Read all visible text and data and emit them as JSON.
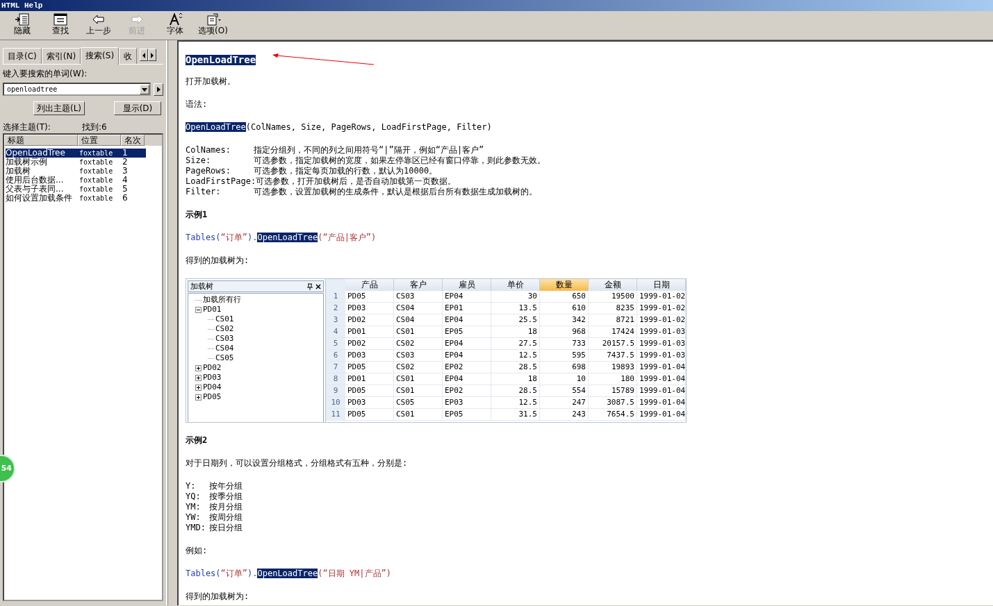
{
  "window": {
    "title": "HTML Help"
  },
  "toolbar": [
    {
      "kind": "hide",
      "label": "隐藏",
      "disabled": false
    },
    {
      "kind": "find",
      "label": "查找",
      "disabled": false
    },
    {
      "kind": "back",
      "label": "上一步",
      "disabled": false
    },
    {
      "kind": "forward",
      "label": "前进",
      "disabled": true
    },
    {
      "kind": "font",
      "label": "字体",
      "disabled": false
    },
    {
      "kind": "options",
      "label": "选项(O)",
      "disabled": false
    }
  ],
  "tabs": [
    {
      "label": "目录(C)",
      "selected": false
    },
    {
      "label": "索引(N)",
      "selected": false
    },
    {
      "label": "搜索(S)",
      "selected": true
    },
    {
      "label": "收",
      "selected": false
    }
  ],
  "search": {
    "label": "键入要搜索的单词(W):",
    "value": "openloadtree"
  },
  "buttons": [
    "列出主题(L)",
    "显示(D)"
  ],
  "results": {
    "label": "选择主题(T):",
    "found": "找到:6",
    "columns": [
      "标题",
      "位置",
      "名次"
    ],
    "rows": [
      {
        "title": "OpenLoadTree",
        "location": "foxtable",
        "rank": "1",
        "selected": true
      },
      {
        "title": "加载树示例",
        "location": "foxtable",
        "rank": "2",
        "selected": false
      },
      {
        "title": "加载树",
        "location": "foxtable",
        "rank": "3",
        "selected": false
      },
      {
        "title": "使用后台数据...",
        "location": "foxtable",
        "rank": "4",
        "selected": false
      },
      {
        "title": "父表与子表同...",
        "location": "foxtable",
        "rank": "5",
        "selected": false
      },
      {
        "title": "如何设置加载条件",
        "location": "foxtable",
        "rank": "6",
        "selected": false
      }
    ]
  },
  "badge": "54",
  "content": {
    "heading": "OpenLoadTree",
    "blocks": [
      {
        "kind": "para",
        "text": "打开加载树。"
      },
      {
        "kind": "para",
        "text": "语法:"
      },
      {
        "kind": "code",
        "parts": [
          {
            "kind": "highlight",
            "text": "OpenLoadTree"
          },
          {
            "kind": "plain",
            "text": "(ColNames, Size, PageRows, LoadFirstPage, Filter)"
          }
        ]
      },
      {
        "kind": "params",
        "items": [
          {
            "name": "ColNames:",
            "desc": "指定分组列，不同的列之间用符号“|”隔开，例如“产品|客户”"
          },
          {
            "name": "Size:",
            "desc": "可选参数，指定加载树的宽度，如果左停靠区已经有窗口停靠，则此参数无效。"
          },
          {
            "name": "PageRows:",
            "desc": "可选参数，指定每页加载的行数，默认为10000。"
          },
          {
            "name": "LoadFirstPage:",
            "desc": "可选参数，打开加载树后，是否自动加载第一页数据。"
          },
          {
            "name": "Filter:",
            "desc": "可选参数，设置加载树的生成条件，默认是根据后台所有数据生成加载树的。"
          }
        ]
      },
      {
        "kind": "title",
        "text": "示例1"
      },
      {
        "kind": "code",
        "parts": [
          {
            "kind": "object",
            "text": "Tables("
          },
          {
            "kind": "string",
            "text": "“订单”"
          },
          {
            "kind": "object",
            "text": ")."
          },
          {
            "kind": "highlight",
            "text": "OpenLoadTree"
          },
          {
            "kind": "string",
            "text": "(“产品|客户”)"
          }
        ]
      },
      {
        "kind": "para",
        "text": "得到的加载树为:"
      },
      {
        "kind": "treegrid",
        "tree_title": "加载树",
        "tree": [
          {
            "kind": "leaf",
            "label": "加载所有行"
          },
          {
            "kind": "group",
            "label": "PD01",
            "expanded": true,
            "children": [
              {
                "kind": "leaf",
                "label": "CS01"
              },
              {
                "kind": "leaf",
                "label": "CS02"
              },
              {
                "kind": "leaf",
                "label": "CS03"
              },
              {
                "kind": "leaf",
                "label": "CS04"
              },
              {
                "kind": "leaf",
                "label": "CS05"
              }
            ]
          },
          {
            "kind": "group",
            "label": "PD02",
            "expanded": false
          },
          {
            "kind": "group",
            "label": "PD03",
            "expanded": false
          },
          {
            "kind": "group",
            "label": "PD04",
            "expanded": false
          },
          {
            "kind": "group",
            "label": "PD05",
            "expanded": false
          }
        ],
        "columns": [
          {
            "label": "产品",
            "kind": "text",
            "selected": false
          },
          {
            "label": "客户",
            "kind": "text",
            "selected": false
          },
          {
            "label": "雇员",
            "kind": "text",
            "selected": false
          },
          {
            "label": "单价",
            "kind": "number",
            "selected": false
          },
          {
            "label": "数量",
            "kind": "number",
            "selected": true
          },
          {
            "label": "金额",
            "kind": "number",
            "selected": false
          },
          {
            "label": "日期",
            "kind": "number",
            "selected": false
          }
        ],
        "rows": [
          {
            "num": "1",
            "cells": [
              "PD05",
              "CS03",
              "EP04",
              "30",
              "650",
              "19500",
              "1999-01-02"
            ]
          },
          {
            "num": "2",
            "cells": [
              "PD03",
              "CS04",
              "EP01",
              "13.5",
              "610",
              "8235",
              "1999-01-02"
            ]
          },
          {
            "num": "3",
            "cells": [
              "PD02",
              "CS04",
              "EP04",
              "25.5",
              "342",
              "8721",
              "1999-01-02"
            ]
          },
          {
            "num": "4",
            "cells": [
              "PD01",
              "CS01",
              "EP05",
              "18",
              "968",
              "17424",
              "1999-01-03"
            ]
          },
          {
            "num": "5",
            "cells": [
              "PD02",
              "CS02",
              "EP04",
              "27.5",
              "733",
              "20157.5",
              "1999-01-03"
            ]
          },
          {
            "num": "6",
            "cells": [
              "PD03",
              "CS03",
              "EP04",
              "12.5",
              "595",
              "7437.5",
              "1999-01-03"
            ]
          },
          {
            "num": "7",
            "cells": [
              "PD05",
              "CS02",
              "EP02",
              "28.5",
              "698",
              "19893",
              "1999-01-04"
            ]
          },
          {
            "num": "8",
            "cells": [
              "PD01",
              "CS01",
              "EP04",
              "18",
              "10",
              "180",
              "1999-01-04"
            ]
          },
          {
            "num": "9",
            "cells": [
              "PD05",
              "CS01",
              "EP02",
              "28.5",
              "554",
              "15789",
              "1999-01-04"
            ]
          },
          {
            "num": "10",
            "cells": [
              "PD03",
              "CS05",
              "EP03",
              "12.5",
              "247",
              "3087.5",
              "1999-01-04"
            ]
          },
          {
            "num": "11",
            "cells": [
              "PD05",
              "CS01",
              "EP05",
              "31.5",
              "243",
              "7654.5",
              "1999-01-04"
            ]
          }
        ]
      },
      {
        "kind": "title",
        "text": "示例2"
      },
      {
        "kind": "para",
        "text": "对于日期列，可以设置分组格式，分组格式有五种，分别是:"
      },
      {
        "kind": "params",
        "items": [
          {
            "name": "Y:",
            "desc": "按年分组"
          },
          {
            "name": "YQ:",
            "desc": "按季分组"
          },
          {
            "name": "YM:",
            "desc": "按月分组"
          },
          {
            "name": "YW:",
            "desc": "按周分组"
          },
          {
            "name": "YMD:",
            "desc": "按日分组"
          }
        ]
      },
      {
        "kind": "para",
        "text": "例如:"
      },
      {
        "kind": "code",
        "parts": [
          {
            "kind": "object",
            "text": "Tables("
          },
          {
            "kind": "string",
            "text": "“订单”"
          },
          {
            "kind": "object",
            "text": ")."
          },
          {
            "kind": "highlight",
            "text": "OpenLoadTree"
          },
          {
            "kind": "string",
            "text": "(“日期 YM|产品”)"
          }
        ]
      },
      {
        "kind": "para",
        "text": "得到的加载树为:"
      }
    ]
  }
}
